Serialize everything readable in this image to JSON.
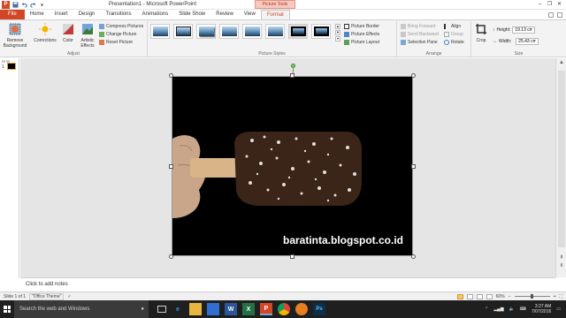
{
  "app": {
    "title": "Presentation1 - Microsoft PowerPoint",
    "context_tab_group": "Picture Tools",
    "logo_letter": "P"
  },
  "tabs": [
    "File",
    "Home",
    "Insert",
    "Design",
    "Transitions",
    "Animations",
    "Slide Show",
    "Review",
    "View",
    "Format"
  ],
  "active_tab": "Format",
  "ribbon": {
    "adjust": {
      "label": "Adjust",
      "remove_background": "Remove Background",
      "corrections": "Corrections",
      "color": "Color",
      "artistic_effects": "Artistic Effects",
      "compress_pictures": "Compress Pictures",
      "change_picture": "Change Picture",
      "reset_picture": "Reset Picture"
    },
    "picture_styles": {
      "label": "Picture Styles",
      "picture_border": "Picture Border",
      "picture_effects": "Picture Effects",
      "picture_layout": "Picture Layout"
    },
    "arrange": {
      "label": "Arrange",
      "bring_forward": "Bring Forward",
      "send_backward": "Send Backward",
      "selection_pane": "Selection Pane",
      "align": "Align",
      "group": "Group",
      "rotate": "Rotate"
    },
    "size": {
      "label": "Size",
      "crop": "Crop",
      "height_label": "Height:",
      "height_value": "19.13 cm",
      "width_label": "Width:",
      "width_value": "25.43 cm"
    }
  },
  "slide": {
    "watermark": "baratinta.blogspot.co.id"
  },
  "notes": {
    "placeholder": "Click to add notes"
  },
  "status": {
    "slide_of": "Slide 1 of 1",
    "theme": "\"Office Theme\"",
    "zoom": "60%"
  },
  "taskbar": {
    "search_placeholder": "Search the web and Windows",
    "time": "3:27 AM",
    "date": "7/07/2016"
  },
  "colors": {
    "accent": "#d24726",
    "taskbar": "#1f1f1f"
  }
}
